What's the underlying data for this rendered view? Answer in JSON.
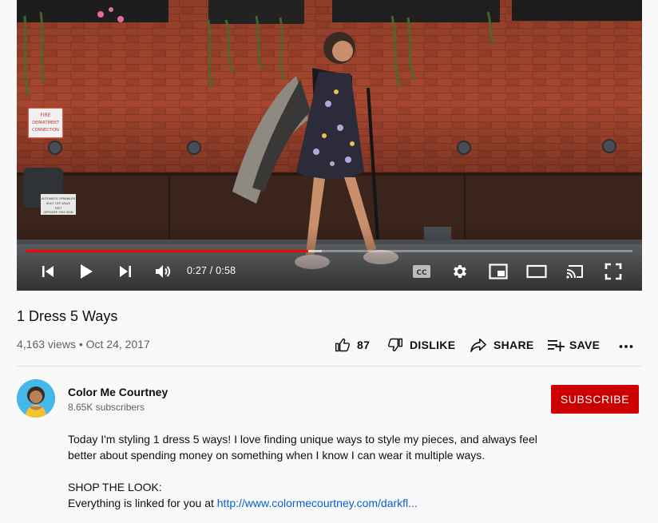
{
  "player": {
    "time_display": "0:27 / 0:58",
    "progress_played": 0.465,
    "progress_loaded": 0.487,
    "cc_label": "CC",
    "scene_signs": {
      "fire_line1": "FIRE",
      "fire_line2": "DEPARTMENT",
      "fire_line3": "CONNECTION",
      "valve_line1": "AUTOMATIC SPRINKLER",
      "valve_line2": "SHUT OFF VALVE",
      "valve_line3": "FEET",
      "valve_line4": "OPPOSITE THIS SIGN"
    },
    "icons": {
      "previous": "skip-previous-icon",
      "play": "play-icon",
      "next": "skip-next-icon",
      "volume": "volume-icon",
      "captions": "closed-captions-icon",
      "settings": "gear-icon",
      "miniplayer": "miniplayer-icon",
      "theater": "theater-mode-icon",
      "cast": "cast-icon",
      "fullscreen": "fullscreen-icon"
    }
  },
  "video": {
    "title": "1 Dress 5 Ways",
    "meta": "4,163 views • Oct 24, 2017"
  },
  "actions": {
    "like_count": "87",
    "dislike_label": "DISLIKE",
    "share_label": "SHARE",
    "save_label": "SAVE"
  },
  "channel": {
    "name": "Color Me Courtney",
    "subscribers": "8.65K subscribers",
    "subscribe_label": "SUBSCRIBE"
  },
  "description": {
    "line1": "Today I'm styling 1 dress 5 ways! I love finding unique ways to style my pieces, and always feel",
    "line2": "better about spending money on something when I know I can wear it multiple ways.",
    "line3": "SHOP THE LOOK:",
    "line4_text": "Everything is linked for you at ",
    "line4_link": "http://www.colormecourtney.com/darkfl..."
  },
  "colors": {
    "accent_red": "#ff0000",
    "subscribe_bg": "#cc0000",
    "link": "#065fd4",
    "meta_gray": "#606060"
  }
}
